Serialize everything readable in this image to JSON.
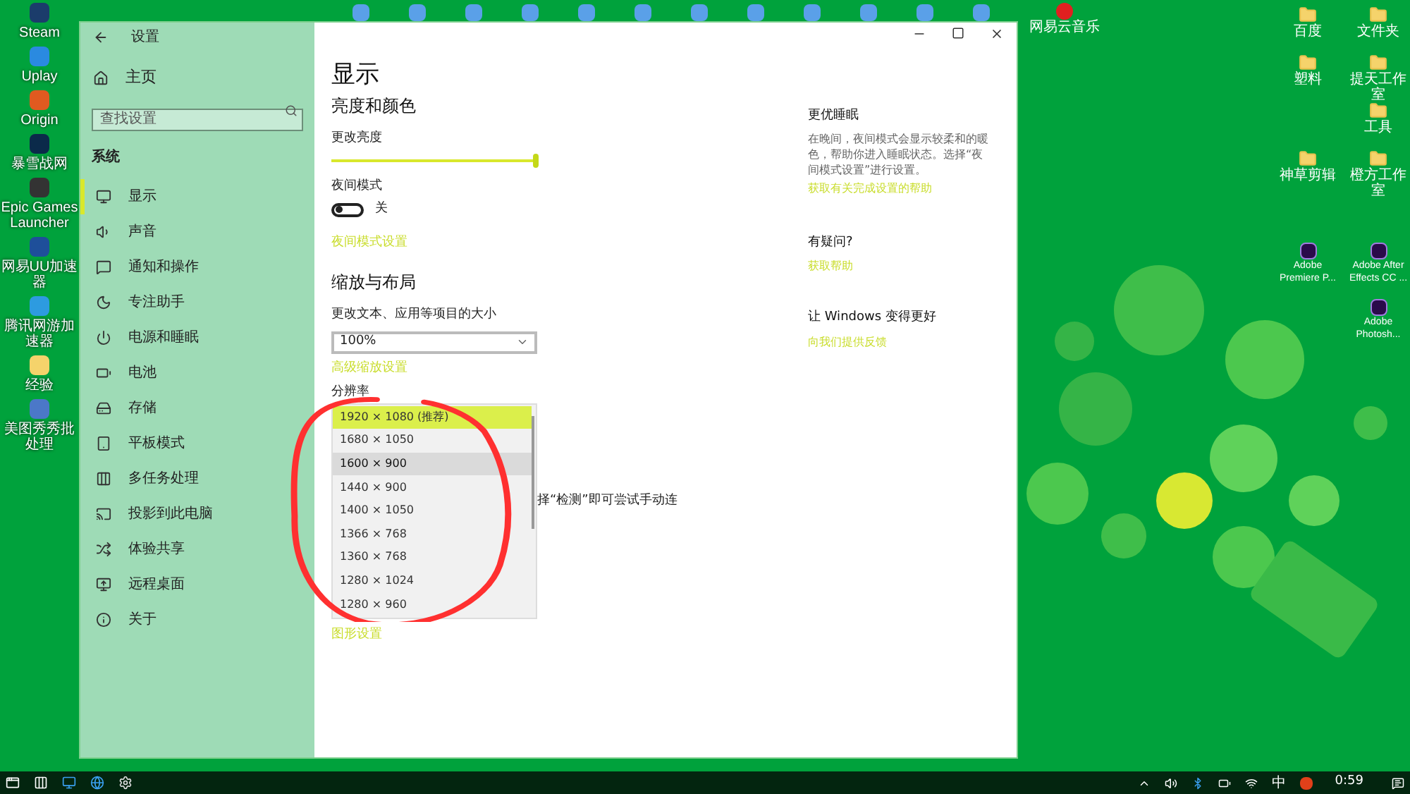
{
  "desktop": {
    "left_icons": [
      {
        "label": "Steam"
      },
      {
        "label": "Uplay"
      },
      {
        "label": "Origin"
      },
      {
        "label": "暴雪战网"
      },
      {
        "label": "Epic Games Launcher"
      },
      {
        "label": "网易UU加速器"
      },
      {
        "label": "腾讯网游加速器"
      },
      {
        "label": "经验"
      },
      {
        "label": "美图秀秀批处理"
      }
    ],
    "right_icons": [
      {
        "label": "百度"
      },
      {
        "label": "文件夹"
      },
      {
        "label": "塑料"
      },
      {
        "label": "提天工作室"
      },
      {
        "label": "工具"
      },
      {
        "label": "神草剪辑"
      },
      {
        "label": "橙方工作室"
      }
    ],
    "adobe_icons": [
      {
        "label": "Adobe Premiere P..."
      },
      {
        "label": "Adobe After Effects CC ..."
      },
      {
        "label": "Adobe Photosh..."
      }
    ],
    "top_icon_label": "网易云音乐"
  },
  "window": {
    "title": "设置",
    "sidebar": {
      "home": "主页",
      "search": {
        "placeholder": "查找设置"
      },
      "section": "系统",
      "items": [
        {
          "label": "显示",
          "selected": true
        },
        {
          "label": "声音",
          "selected": false
        },
        {
          "label": "通知和操作",
          "selected": false
        },
        {
          "label": "专注助手",
          "selected": false
        },
        {
          "label": "电源和睡眠",
          "selected": false
        },
        {
          "label": "电池",
          "selected": false
        },
        {
          "label": "存储",
          "selected": false
        },
        {
          "label": "平板模式",
          "selected": false
        },
        {
          "label": "多任务处理",
          "selected": false
        },
        {
          "label": "投影到此电脑",
          "selected": false
        },
        {
          "label": "体验共享",
          "selected": false
        },
        {
          "label": "远程桌面",
          "selected": false
        },
        {
          "label": "关于",
          "selected": false
        }
      ]
    },
    "main": {
      "heading": "显示",
      "brightness_section": "亮度和颜色",
      "brightness_label": "更改亮度",
      "brightness": {
        "level": 0.99
      },
      "night_label": "夜间模式",
      "night_toggle": {
        "on": false,
        "state_text": "关"
      },
      "night_link": "夜间模式设置",
      "scale_section": "缩放与布局",
      "scale_label": "更改文本、应用等项目的大小",
      "scale_select": {
        "value": "100%"
      },
      "scale_link": "高级缩放设置",
      "resolution_label": "分辨率",
      "resolution_options": [
        {
          "label": "1920 × 1080 (推荐)",
          "selected": true,
          "hovered": false
        },
        {
          "label": "1680 × 1050",
          "selected": false,
          "hovered": false
        },
        {
          "label": "1600 × 900",
          "selected": false,
          "hovered": true
        },
        {
          "label": "1440 × 900",
          "selected": false,
          "hovered": false
        },
        {
          "label": "1400 × 1050",
          "selected": false,
          "hovered": false
        },
        {
          "label": "1366 × 768",
          "selected": false,
          "hovered": false
        },
        {
          "label": "1360 × 768",
          "selected": false,
          "hovered": false
        },
        {
          "label": "1280 × 1024",
          "selected": false,
          "hovered": false
        },
        {
          "label": "1280 × 960",
          "selected": false,
          "hovered": false
        }
      ],
      "hidden_text": "择“检测”即可尝试手动连",
      "graphics_link": "图形设置"
    },
    "aside": {
      "sleep_title": "更优睡眠",
      "sleep_text": "在晚间，夜间模式会显示较柔和的暖色，帮助你进入睡眠状态。选择“夜间模式设置”进行设置。",
      "sleep_link": "获取有关完成设置的帮助",
      "question_title": "有疑问?",
      "help_link": "获取帮助",
      "feedback_title": "让 Windows 变得更好",
      "feedback_link": "向我们提供反馈"
    }
  },
  "taskbar": {
    "ime": "中",
    "time": "0:59"
  }
}
